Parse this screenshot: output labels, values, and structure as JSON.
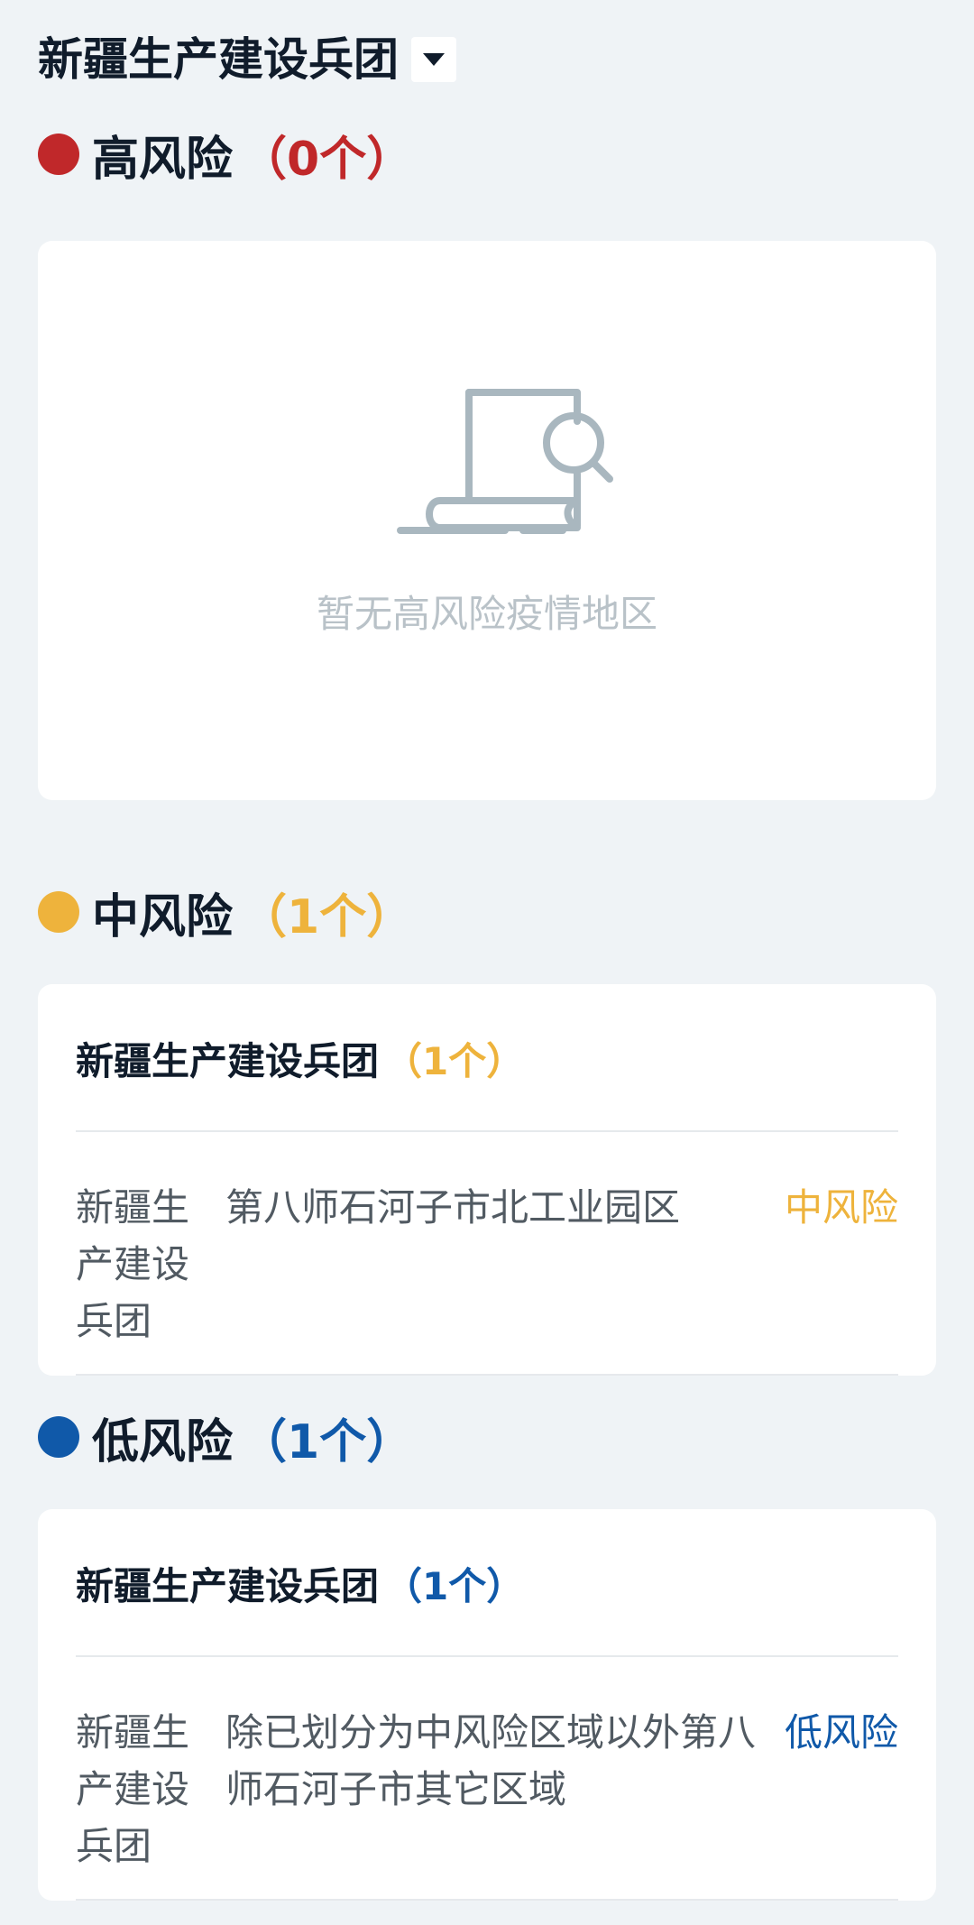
{
  "region_selector": {
    "name": "新疆生产建设兵团",
    "icon": "caret-down-icon"
  },
  "colors": {
    "high": "#c0282a",
    "medium": "#eeb33c",
    "low": "#1059a9"
  },
  "high_risk": {
    "title": "高风险",
    "count_label": "（0个）",
    "empty_icon": "document-search-icon",
    "empty_text": "暂无高风险疫情地区"
  },
  "medium_risk": {
    "title": "中风险",
    "count_label": "（1个）",
    "group": {
      "name": "新疆生产建设兵团",
      "count_label": "（1个）",
      "rows": [
        {
          "region": "新疆生产建设兵团",
          "area": "第八师石河子市北工业园区",
          "level": "中风险"
        }
      ]
    }
  },
  "low_risk": {
    "title": "低风险",
    "count_label": "（1个）",
    "group": {
      "name": "新疆生产建设兵团",
      "count_label": "（1个）",
      "rows": [
        {
          "region": "新疆生产建设兵团",
          "area": "除已划分为中风险区域以外第八师石河子市其它区域",
          "level": "低风险"
        }
      ]
    }
  }
}
